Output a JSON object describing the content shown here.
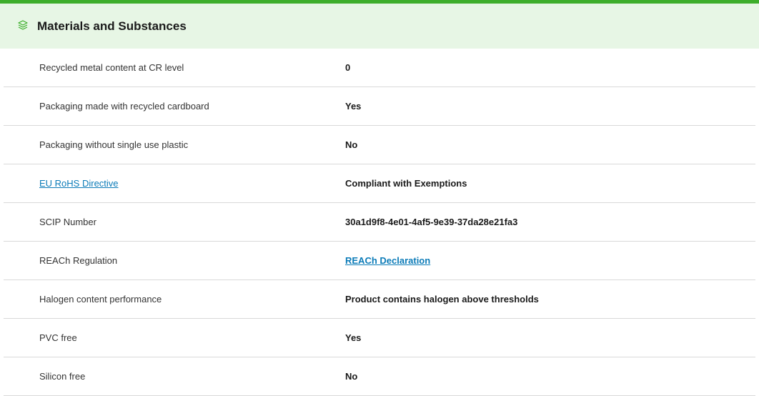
{
  "section": {
    "title": "Materials and Substances",
    "icon": "layers-leaf-icon",
    "accent_color": "#3dae2b",
    "header_bg": "#e7f6e5"
  },
  "rows": [
    {
      "label": "Recycled metal content at CR level",
      "value": "0"
    },
    {
      "label": "Packaging made with recycled cardboard",
      "value": "Yes"
    },
    {
      "label": "Packaging without single use plastic",
      "value": "No"
    },
    {
      "label": "EU RoHS Directive",
      "value": "Compliant with Exemptions",
      "label_is_link": true
    },
    {
      "label": "SCIP Number",
      "value": "30a1d9f8-4e01-4af5-9e39-37da28e21fa3"
    },
    {
      "label": "REACh Regulation",
      "value": "REACh Declaration",
      "value_is_link": true
    },
    {
      "label": "Halogen content performance",
      "value": "Product contains halogen above thresholds"
    },
    {
      "label": "PVC free",
      "value": "Yes"
    },
    {
      "label": "Silicon free",
      "value": "No"
    }
  ],
  "link_color": "#0b7bb8"
}
